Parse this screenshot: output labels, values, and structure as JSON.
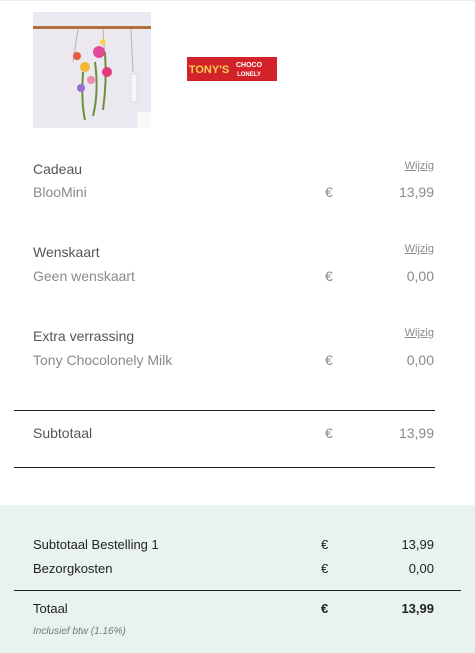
{
  "product_image": {
    "alt_icon": "flower-bouquet-image"
  },
  "extra_logo": {
    "line1": "TONY'S",
    "line2": "CHOCO",
    "line3": "LONELY"
  },
  "items": [
    {
      "heading": "Cadeau",
      "name": "BlooMini",
      "currency": "€",
      "price": "13,99",
      "edit_label": "Wijzig"
    },
    {
      "heading": "Wenskaart",
      "name": "Geen wenskaart",
      "currency": "€",
      "price": "0,00",
      "edit_label": "Wijzig"
    },
    {
      "heading": "Extra verrassing",
      "name": "Tony Chocolonely Milk",
      "currency": "€",
      "price": "0,00",
      "edit_label": "Wijzig"
    }
  ],
  "subtotal": {
    "label": "Subtotaal",
    "currency": "€",
    "amount": "13,99"
  },
  "summary": {
    "order_subtotal": {
      "label": "Subtotaal Bestelling 1",
      "currency": "€",
      "amount": "13,99"
    },
    "shipping": {
      "label": "Bezorgkosten",
      "currency": "€",
      "amount": "0,00"
    },
    "total": {
      "label": "Totaal",
      "currency": "€",
      "amount": "13,99"
    },
    "vat_note": "Inclusief btw (1.16%)"
  },
  "colors": {
    "summary_bg": "#e8f2f0",
    "choco_red": "#d2232a"
  }
}
